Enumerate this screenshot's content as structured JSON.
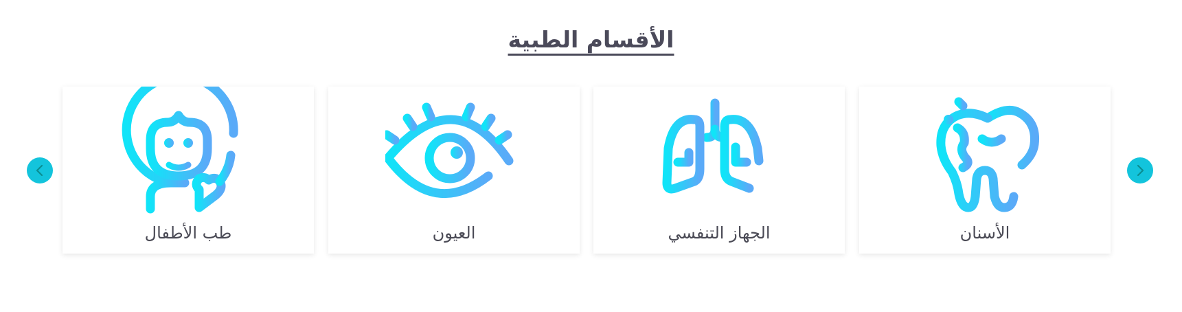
{
  "section": {
    "title": "الأقسام الطبية"
  },
  "carousel": {
    "prev_icon": "chevron-left-icon",
    "next_icon": "chevron-right-icon",
    "accent_color": "#13c4dc",
    "icon_gradient": [
      "#10e4f8",
      "#5aaaf8"
    ],
    "cards": [
      {
        "label": "طب الأطفال",
        "icon": "child-heart-icon"
      },
      {
        "label": "العيون",
        "icon": "eye-icon"
      },
      {
        "label": "الجهاز التنفسي",
        "icon": "lungs-icon"
      },
      {
        "label": "الأسنان",
        "icon": "tooth-icon"
      }
    ]
  }
}
